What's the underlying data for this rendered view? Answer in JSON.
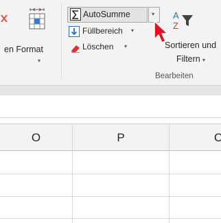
{
  "ribbon": {
    "format_label": "en Format",
    "autosum_label": "AutoSumme",
    "fill_label": "Füllbereich",
    "clear_label": "Löschen",
    "sort_label_line1": "Sortieren und",
    "sort_label_line2": "Filtern",
    "group_label": "Bearbeiten",
    "dropdown_glyph": "▾"
  },
  "grid": {
    "columns": [
      "O",
      "P",
      "C"
    ]
  },
  "colors": {
    "ribbon_bg": "#f3f3f3",
    "cursor": "#e81123",
    "fill_icon": "#1e6fc9",
    "eraser": "#e03030"
  }
}
